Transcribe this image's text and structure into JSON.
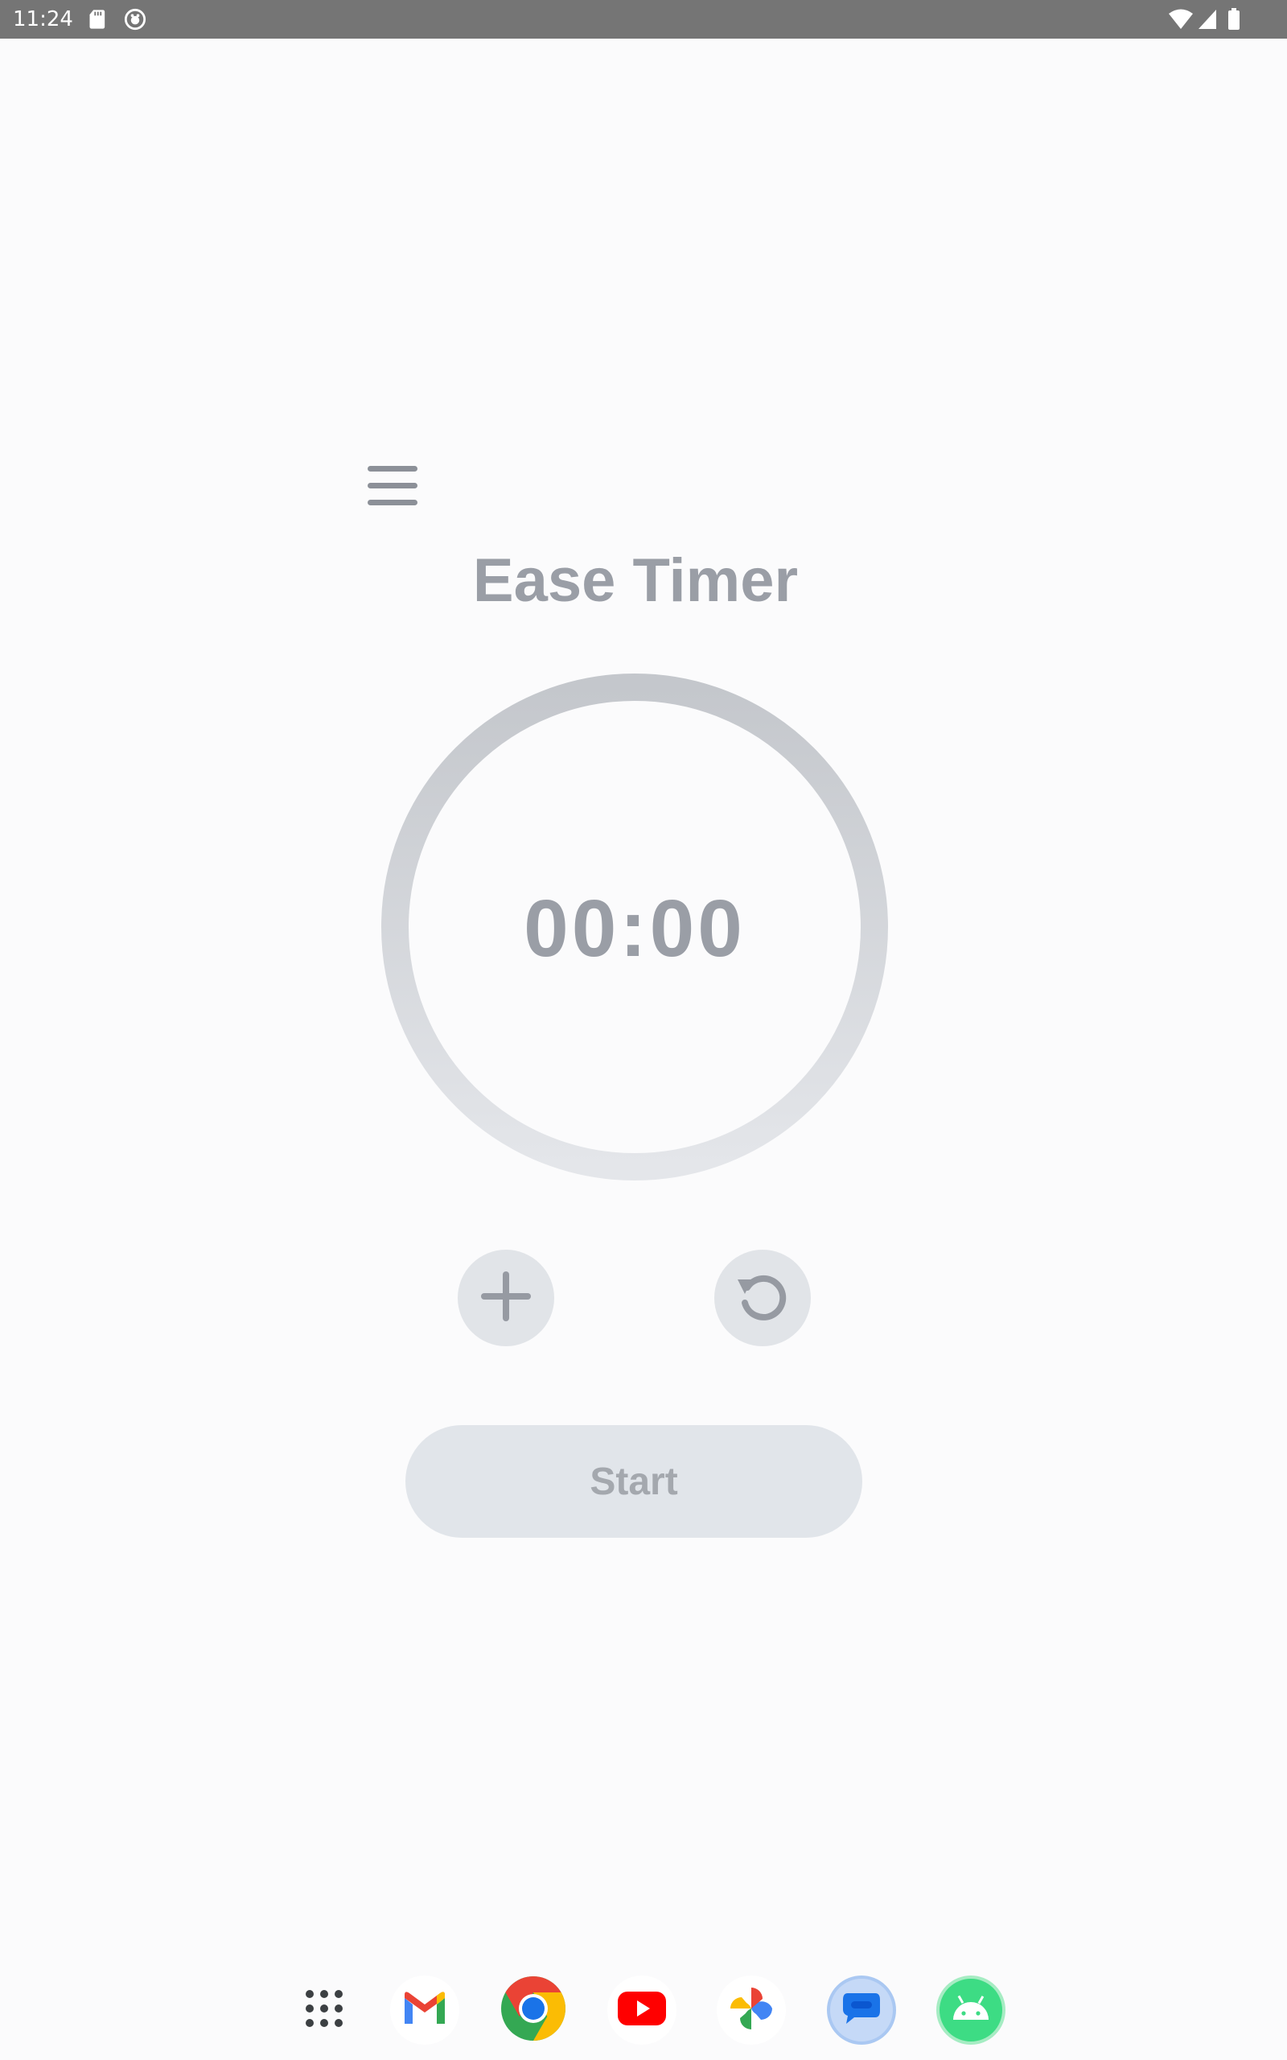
{
  "status_bar": {
    "time": "11:24",
    "left_icons": [
      "sd-card-icon",
      "notification-app-icon"
    ],
    "right_icons": [
      "wifi-icon",
      "cell-signal-icon",
      "battery-icon"
    ]
  },
  "app": {
    "title": "Ease Timer",
    "timer_value": "00:00",
    "start_label": "Start",
    "menu_icon": "hamburger-menu-icon",
    "add_icon": "plus-icon",
    "reset_icon": "reset-icon"
  },
  "dock": {
    "apps": [
      "app-drawer",
      "Gmail",
      "Chrome",
      "YouTube",
      "Photos",
      "Messages",
      "Android"
    ]
  },
  "colors": {
    "background": "#fbfbfc",
    "status_bar": "#757575",
    "text_muted": "#9a9ea6",
    "button_bg": "#e1e4e8",
    "ring": "#c9ccd1"
  }
}
